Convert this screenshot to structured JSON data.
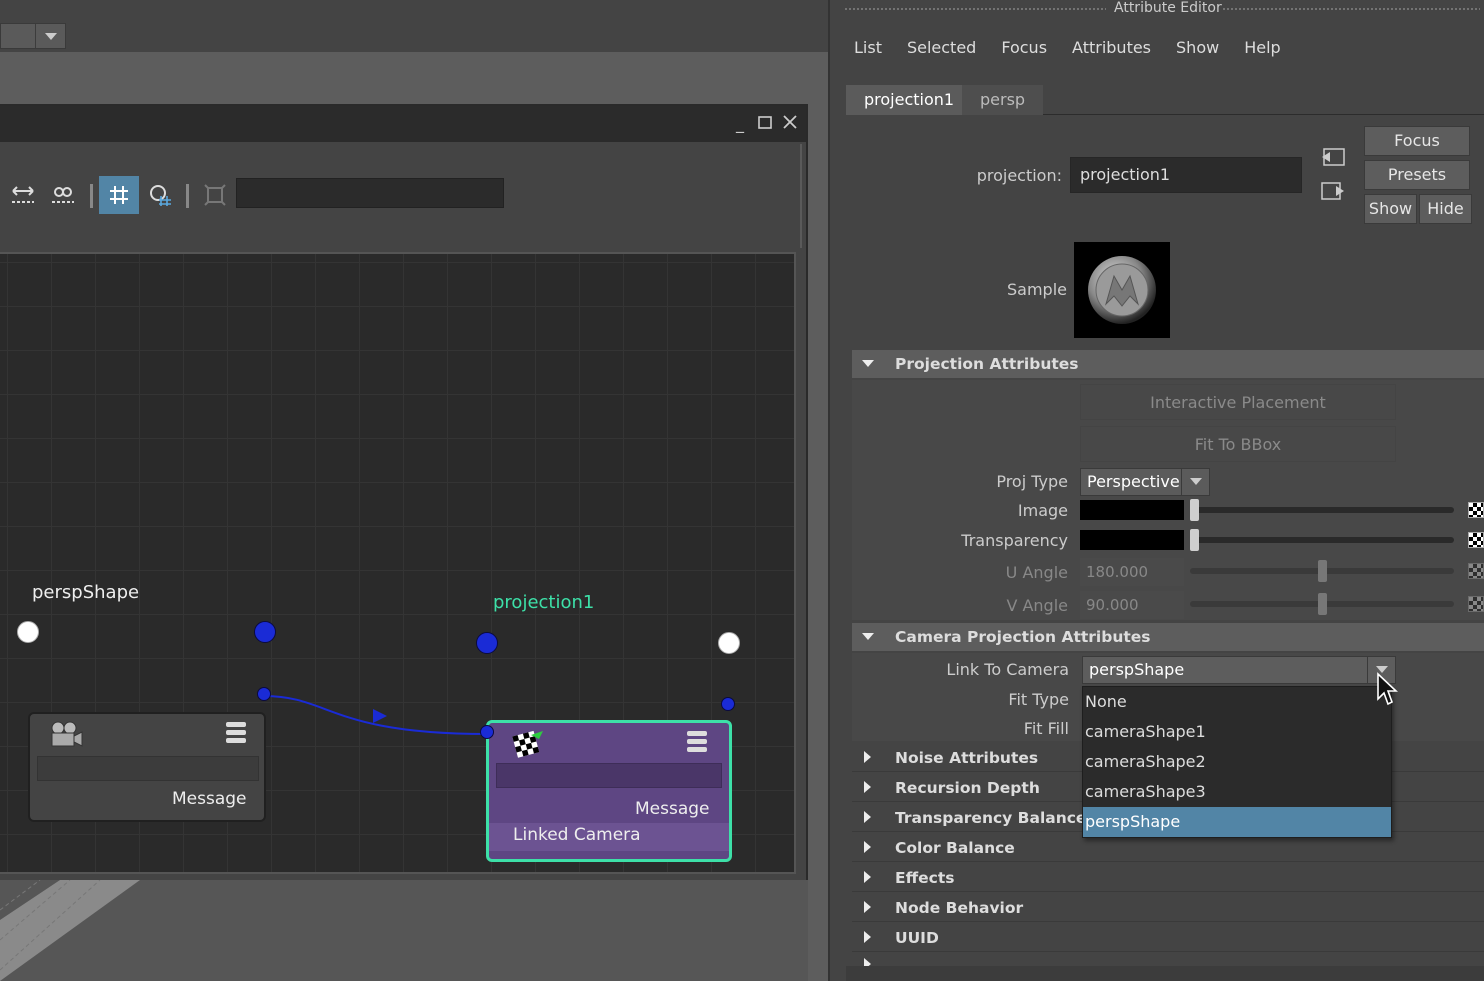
{
  "node_editor": {
    "nodes": {
      "persp_shape": {
        "title": "perspShape",
        "port_label": "Message"
      },
      "projection1": {
        "title": "projection1",
        "message_label": "Message",
        "linked_label": "Linked Camera"
      }
    }
  },
  "attribute_editor": {
    "title": "Attribute Editor",
    "menu": [
      "List",
      "Selected",
      "Focus",
      "Attributes",
      "Show",
      "Help"
    ],
    "tabs": [
      "projection1",
      "persp"
    ],
    "node_type_label": "projection:",
    "node_name_value": "projection1",
    "buttons": {
      "focus": "Focus",
      "presets": "Presets",
      "show": "Show",
      "hide": "Hide"
    },
    "sample_label": "Sample",
    "projection_section": {
      "title": "Projection Attributes",
      "interactive_placement": "Interactive Placement",
      "fit_to_bbox": "Fit To BBox",
      "proj_type_label": "Proj Type",
      "proj_type_value": "Perspective",
      "image_label": "Image",
      "transparency_label": "Transparency",
      "u_angle_label": "U Angle",
      "u_angle_value": "180.000",
      "v_angle_label": "V Angle",
      "v_angle_value": "90.000"
    },
    "camera_section": {
      "title": "Camera Projection Attributes",
      "link_to_camera_label": "Link To Camera",
      "link_to_camera_value": "perspShape",
      "fit_type_label": "Fit Type",
      "fit_fill_label": "Fit Fill",
      "dropdown_options": [
        "None",
        "cameraShape1",
        "cameraShape2",
        "cameraShape3",
        "perspShape"
      ],
      "dropdown_selected": "perspShape"
    },
    "collapsed_sections": [
      "Noise Attributes",
      "Recursion Depth",
      "Transparency Balance",
      "Color Balance",
      "Effects",
      "Node Behavior",
      "UUID"
    ]
  },
  "colors": {
    "selection_blue": "#5285a6",
    "projection_node_fill": "#5e4683",
    "projection_node_border": "#3de0a8",
    "projection_title": "#3de0a8",
    "port_blue": "#1a2bd6"
  }
}
